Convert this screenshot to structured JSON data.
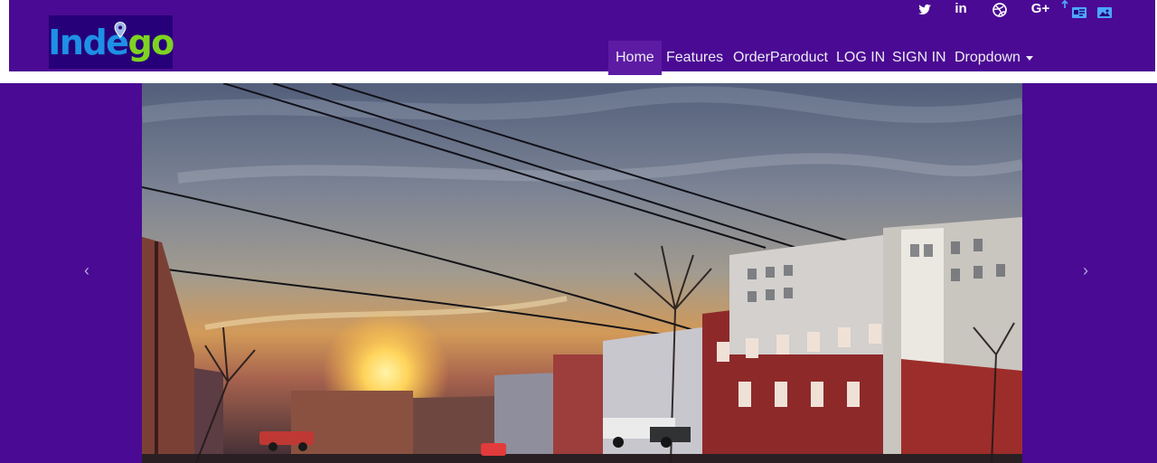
{
  "brand": {
    "text_left": "Inde",
    "text_right": "go"
  },
  "social_links": [
    {
      "name": "twitter",
      "label": ""
    },
    {
      "name": "linkedin",
      "label": "in"
    },
    {
      "name": "dribbble",
      "label": ""
    },
    {
      "name": "google-plus",
      "label": "G+"
    }
  ],
  "nav": {
    "items": [
      {
        "label": "Home",
        "active": true
      },
      {
        "label": "Features",
        "active": false
      },
      {
        "label": "OrderParoduct",
        "active": false
      },
      {
        "label": "LOG IN",
        "active": false
      },
      {
        "label": "SIGN IN",
        "active": false
      },
      {
        "label": "Dropdown",
        "active": false
      }
    ]
  },
  "carousel": {
    "prev_label": "‹",
    "next_label": "›"
  },
  "colors": {
    "background": "#4a0a93",
    "brand_blue": "#1e90e6",
    "brand_green": "#7ed321",
    "active_nav": "#5d1ba4"
  }
}
